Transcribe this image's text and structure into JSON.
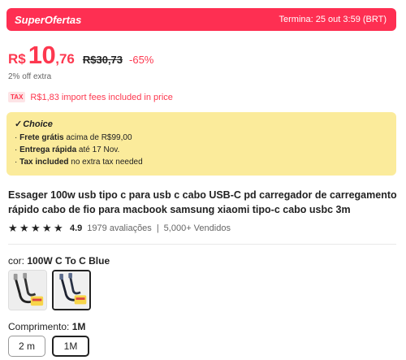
{
  "banner": {
    "brand": "SuperOfertas",
    "timer": "Termina: 25 out 3:59 (BRT)"
  },
  "price": {
    "currency": "R$",
    "integer": "10",
    "decimal": ",76",
    "old": "R$30,73",
    "discount": "-65%"
  },
  "extra_off": "2% off extra",
  "tax": {
    "badge": "TAX",
    "text": "R$1,83 import fees included in price"
  },
  "choice": {
    "title": "Choice",
    "items": [
      {
        "bold": "Frete grátis",
        "rest": " acima de R$99,00"
      },
      {
        "bold": "Entrega rápida",
        "rest": " até 17 Nov."
      },
      {
        "bold": "Tax included",
        "rest": " no extra tax needed"
      }
    ]
  },
  "product": {
    "title": "Essager 100w usb tipo c para usb c cabo USB-C pd carregador de carregamento rápido cabo de fio para macbook samsung xiaomi tipo-c cabo usbc 3m",
    "rating": 4.9,
    "rating_text": "4.9",
    "reviews": "1979 avaliações",
    "separator": "|",
    "sold": "5,000+ Vendidos"
  },
  "color": {
    "label": "cor:",
    "selected": "100W C To C Blue"
  },
  "length": {
    "label": "Comprimento:",
    "selected": "1M",
    "options": [
      "2 m",
      "1M"
    ]
  },
  "colors": {
    "accent": "#fe2f52",
    "price": "#fd384f",
    "choice_bg": "#fbeb9b"
  }
}
